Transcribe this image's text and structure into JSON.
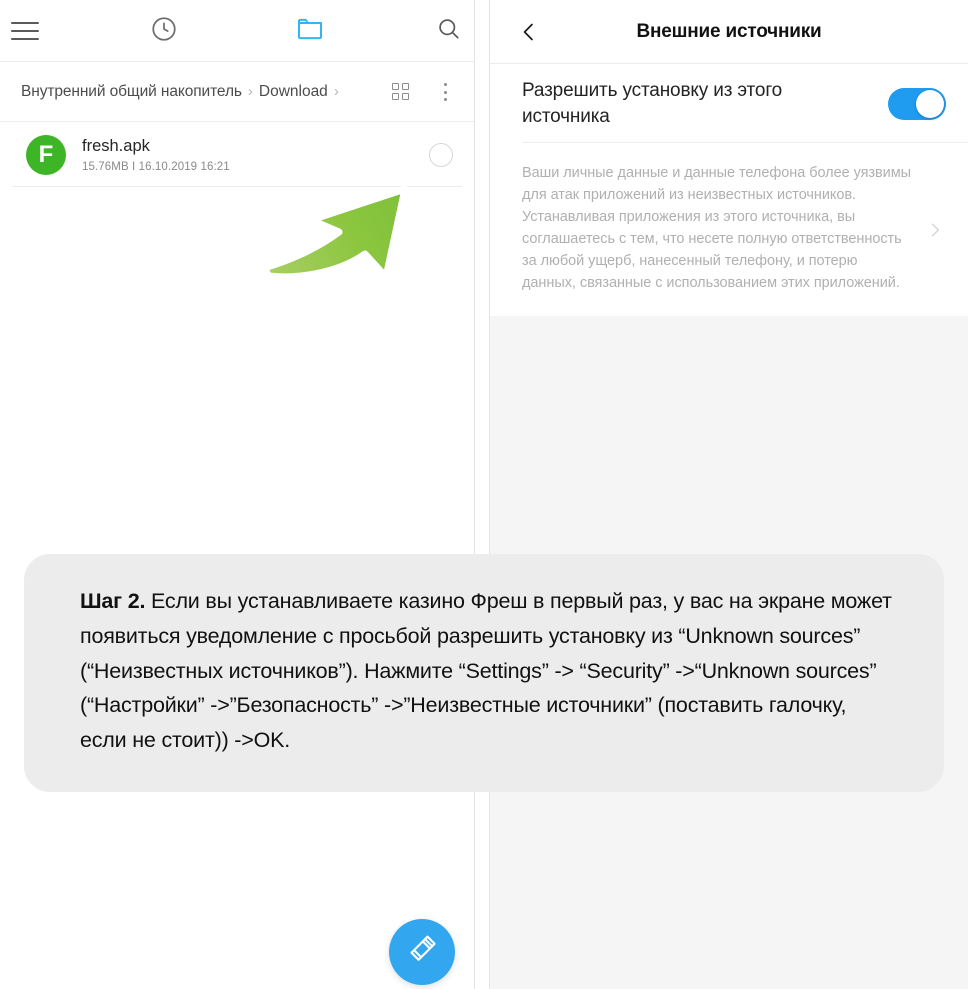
{
  "file_manager": {
    "tabs": [
      {
        "name": "menu-icon",
        "label": "Меню"
      },
      {
        "name": "recent-icon",
        "label": "Недавние"
      },
      {
        "name": "folder-icon",
        "label": "Папки",
        "active": true
      },
      {
        "name": "search-icon",
        "label": "Поиск"
      }
    ],
    "breadcrumb": {
      "root": "Внутренний общий накопитель",
      "separator": "›",
      "current": "Download",
      "trailing_separator": "›"
    },
    "view_toggle_icon": "grid-view-icon",
    "overflow_icon": "more-vertical-icon",
    "files": [
      {
        "avatar_letter": "F",
        "avatar_color": "#3DB526",
        "name": "fresh.apk",
        "size": "15.76MB",
        "meta_separator": "I",
        "date": "16.10.2019 16:21",
        "selected": false
      }
    ],
    "fab": {
      "icon": "paint-brush-icon",
      "color": "#32A7F0"
    },
    "annotation_arrow": {
      "icon": "curved-arrow-icon",
      "color": "#8CC63F"
    }
  },
  "settings": {
    "back_icon": "chevron-left-icon",
    "title": "Внешние источники",
    "toggle_row": {
      "label": "Разрешить установку из этого источника",
      "enabled": true,
      "accent_color": "#1F9CF0"
    },
    "description": "Ваши личные данные и данные телефона более уязвимы для атак приложений из неизвестных источников. Устанавливая приложения из этого источника, вы соглашаетесь с тем, что несете полную ответственность за любой ущерб, нанесенный телефону, и потерю данных, связанные с использованием этих приложений.",
    "chevron_icon": "chevron-right-icon"
  },
  "caption": {
    "step_label": "Шаг 2.",
    "body": " Если вы устанавливаете казино Фреш в первый раз, у вас на экране может появиться уведомление с просьбой разрешить установку из “Unknown sources” (“Неизвестных источников”). Нажмите “Settings” -> “Security” ->“Unknown sources” (“Настройки” ->”Безопасность” ->”Неизвестные источники” (поставить галочку, если не стоит)) ->OK.",
    "background_color": "#ECECEC"
  }
}
